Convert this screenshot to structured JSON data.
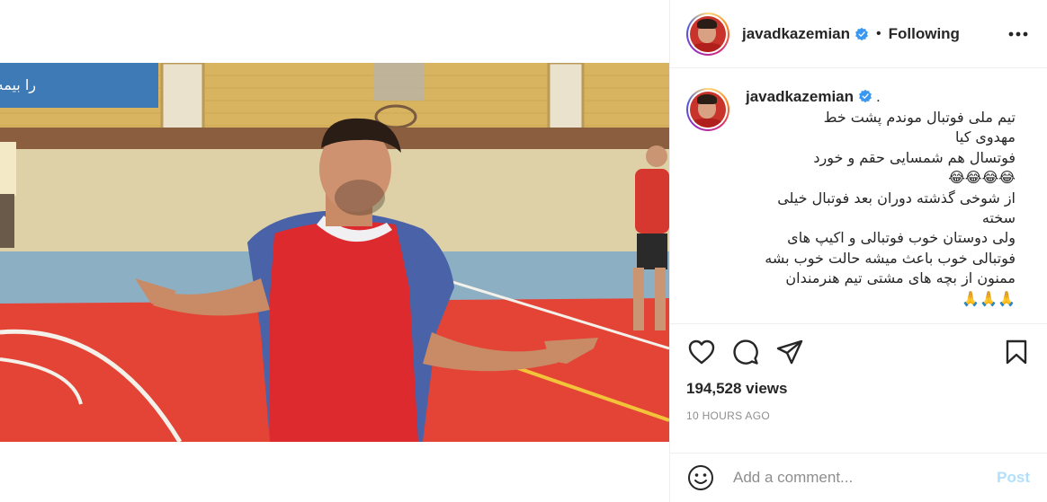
{
  "post": {
    "username": "javadkazemian",
    "follow_state": "Following",
    "separator": "•"
  },
  "caption": {
    "username": "javadkazemian",
    "suffix": ".",
    "lines": [
      "تیم ملی فوتبال موندم پشت خط",
      "مهدوی کیا",
      "فوتسال هم شمسایی حقم و خورد",
      "😂😂😂😂",
      "از شوخی گذشته دوران بعد فوتبال خیلی",
      "سخته",
      "ولی دوستان خوب فوتبالی و اکیپ های",
      "فوتبالی خوب باعث میشه حالت خوب بشه",
      "ممنون از بچه های مشتی تیم هنرمندان",
      "🙏🙏🙏"
    ]
  },
  "stats": {
    "views": "194,528 views",
    "time": "10 HOURS AGO"
  },
  "comment": {
    "placeholder": "Add a comment...",
    "post_label": "Post"
  },
  "video": {
    "banner_text": "را بیمه کنی"
  },
  "icons": {
    "verified": "verified-badge-icon",
    "more": "more-options-icon",
    "like": "heart-icon",
    "comment": "comment-icon",
    "share": "paper-plane-icon",
    "save": "bookmark-icon",
    "emoji": "emoji-icon"
  },
  "colors": {
    "verified_blue": "#3897f0",
    "post_disabled": "#b2dffc",
    "muted_text": "#8e8e8e",
    "divider": "#efefef"
  }
}
